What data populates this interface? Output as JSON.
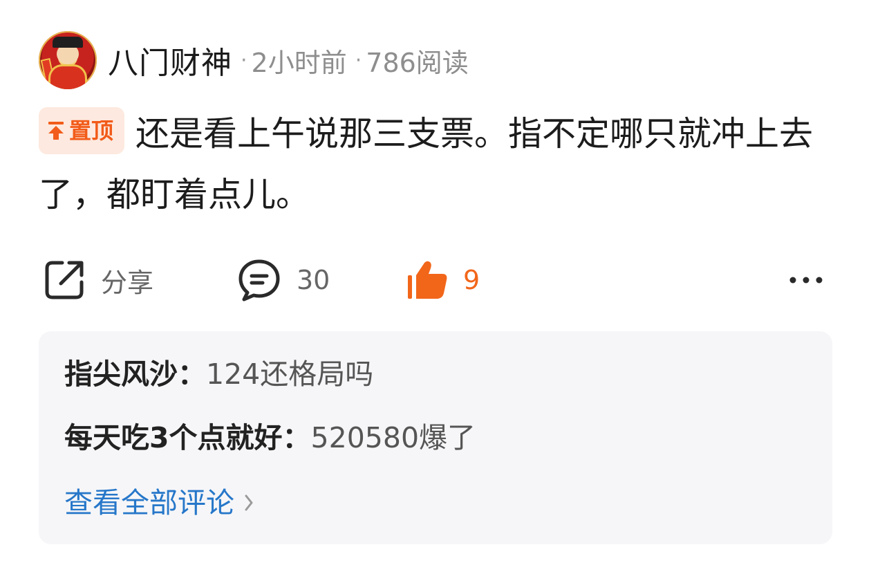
{
  "author": {
    "name": "八门财神",
    "time": "2小时前",
    "reads": "786阅读"
  },
  "post": {
    "pin_label": "置顶",
    "text": "还是看上午说那三支票。指不定哪只就冲上去了，都盯着点儿。"
  },
  "actions": {
    "share_label": "分享",
    "comment_count": "30",
    "like_count": "9"
  },
  "comments": [
    {
      "user": "指尖风沙",
      "text": "124还格局吗"
    },
    {
      "user": "每天吃3个点就好",
      "text": "520580爆了"
    }
  ],
  "view_all_label": "查看全部评论",
  "colors": {
    "accent_orange": "#f2661a",
    "link_blue": "#2677c9",
    "pin_bg": "#fde9df"
  }
}
